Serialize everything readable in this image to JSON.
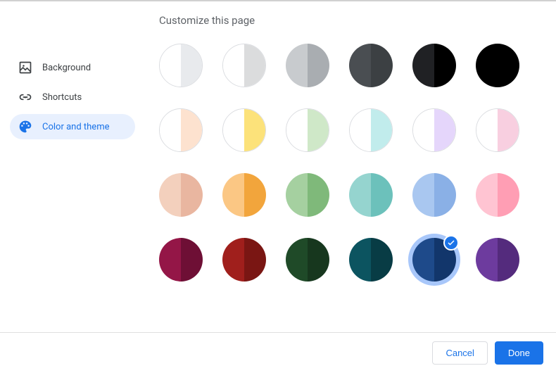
{
  "title": "Customize this page",
  "sidebar": {
    "items": [
      {
        "label": "Background",
        "active": false
      },
      {
        "label": "Shortcuts",
        "active": false
      },
      {
        "label": "Color and theme",
        "active": true
      }
    ]
  },
  "swatches": [
    {
      "left": "#ffffff",
      "right": "#e8eaed",
      "border": true,
      "selected": false
    },
    {
      "left": "#ffffff",
      "right": "#dbdcdd",
      "border": true,
      "selected": false
    },
    {
      "left": "#c8cbce",
      "right": "#a9adb1",
      "border": false,
      "selected": false
    },
    {
      "left": "#4a4e52",
      "right": "#3c4043",
      "border": false,
      "selected": false
    },
    {
      "left": "#202124",
      "right": "#000000",
      "border": false,
      "selected": false
    },
    {
      "left": "#000000",
      "right": "#000000",
      "border": false,
      "selected": false
    },
    {
      "left": "#ffffff",
      "right": "#fde2cf",
      "border": true,
      "selected": false
    },
    {
      "left": "#ffffff",
      "right": "#fce27a",
      "border": true,
      "selected": false
    },
    {
      "left": "#ffffff",
      "right": "#cfe8c8",
      "border": true,
      "selected": false
    },
    {
      "left": "#ffffff",
      "right": "#c1ecec",
      "border": true,
      "selected": false
    },
    {
      "left": "#ffffff",
      "right": "#e5d6fb",
      "border": true,
      "selected": false
    },
    {
      "left": "#ffffff",
      "right": "#f8cfe0",
      "border": true,
      "selected": false
    },
    {
      "left": "#f3d0bd",
      "right": "#e9b6a0",
      "border": false,
      "selected": false
    },
    {
      "left": "#fbc784",
      "right": "#f2a53c",
      "border": false,
      "selected": false
    },
    {
      "left": "#a5d0a0",
      "right": "#7fb97a",
      "border": false,
      "selected": false
    },
    {
      "left": "#95d4cf",
      "right": "#6cc1bb",
      "border": false,
      "selected": false
    },
    {
      "left": "#a9c7f0",
      "right": "#8ab0e6",
      "border": false,
      "selected": false
    },
    {
      "left": "#ffc4d2",
      "right": "#ff9eb4",
      "border": false,
      "selected": false
    },
    {
      "left": "#941647",
      "right": "#6e0f35",
      "border": false,
      "selected": false
    },
    {
      "left": "#a01f1c",
      "right": "#7a1613",
      "border": false,
      "selected": false
    },
    {
      "left": "#1f4a28",
      "right": "#17371e",
      "border": false,
      "selected": false
    },
    {
      "left": "#0c5460",
      "right": "#083c45",
      "border": false,
      "selected": false
    },
    {
      "left": "#1e4a8a",
      "right": "#12366b",
      "border": false,
      "selected": true
    },
    {
      "left": "#6d3b9e",
      "right": "#542b7d",
      "border": false,
      "selected": false
    }
  ],
  "footer": {
    "cancel": "Cancel",
    "done": "Done"
  }
}
